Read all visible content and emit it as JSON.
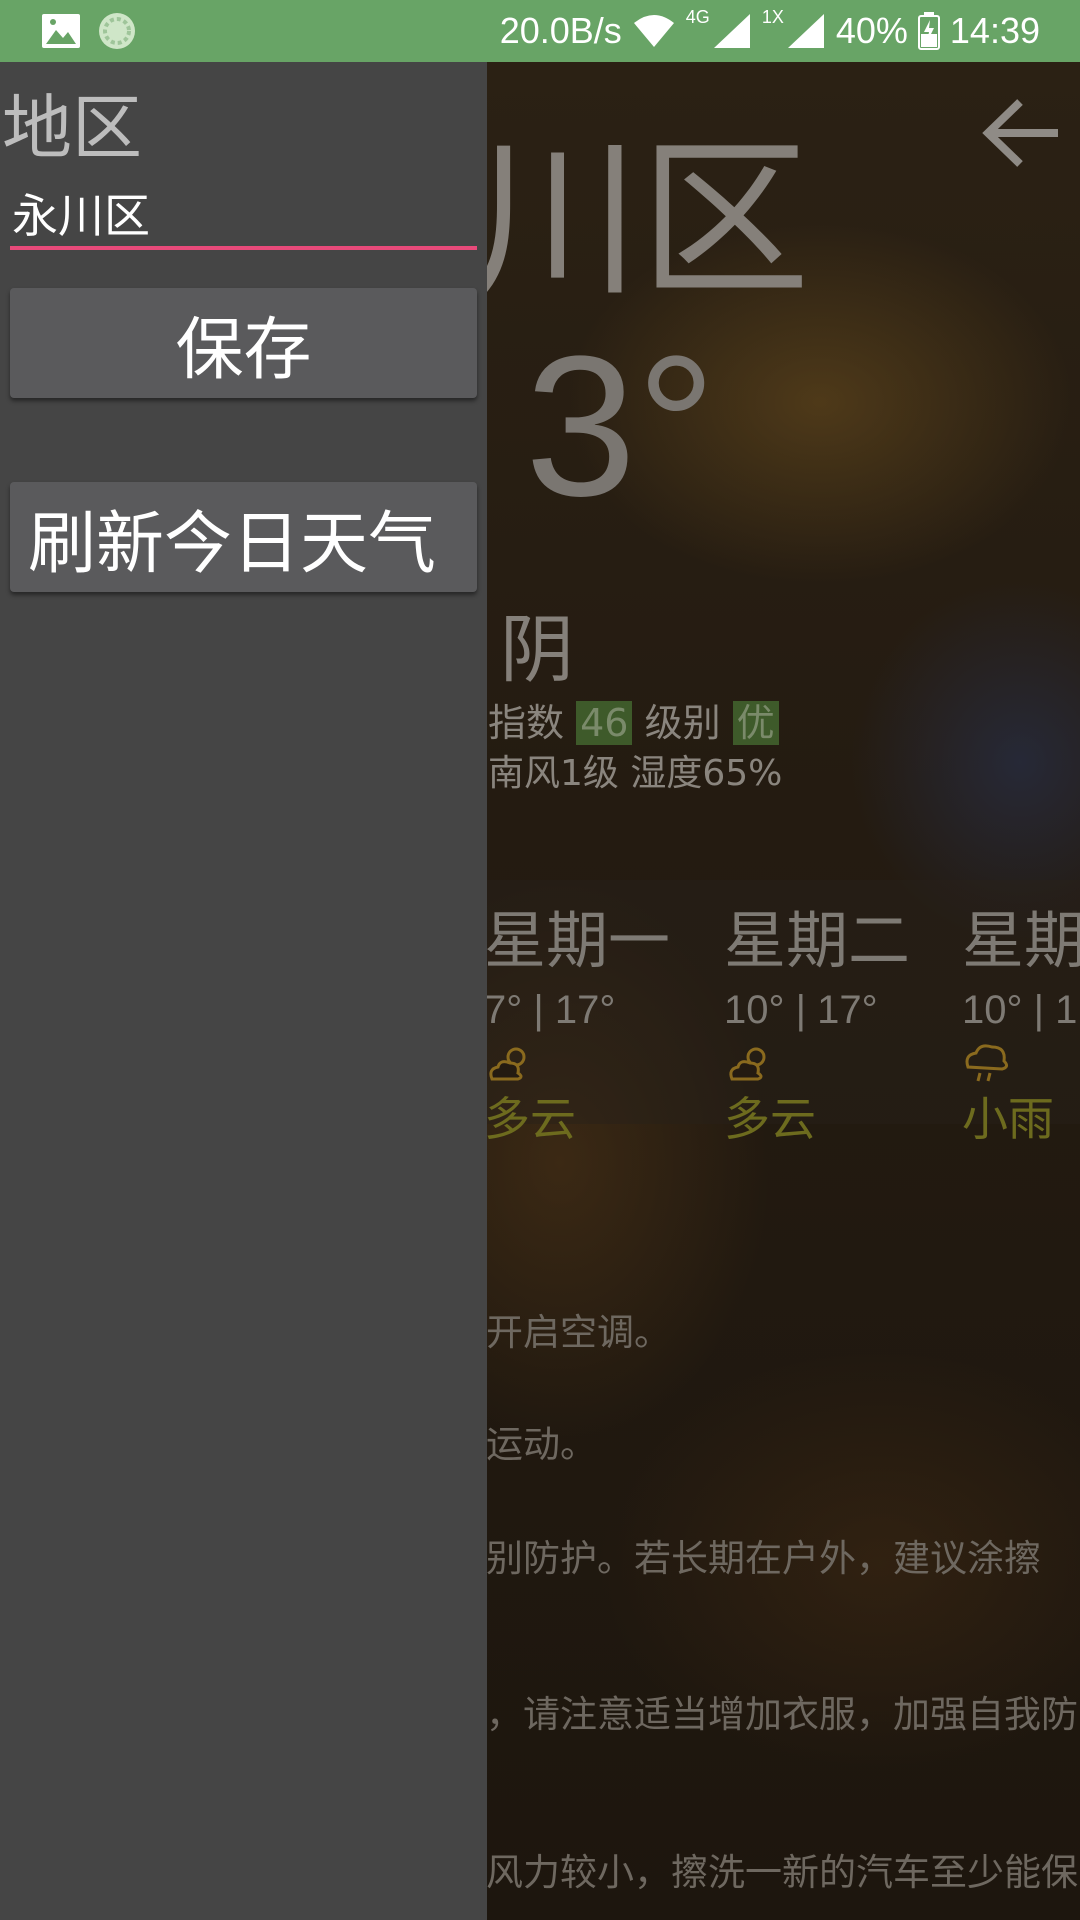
{
  "status_bar": {
    "net_speed": "20.0B/s",
    "net_4g": "4G",
    "net_1x": "1X",
    "battery": "40%",
    "time": "14:39"
  },
  "weather": {
    "city_partial": "川区",
    "temperature": "3°",
    "condition": "阴",
    "aqi_label": "指数",
    "aqi_value": "46",
    "level_label": "级别",
    "level_value": "优",
    "wind_humidity": "南风1级 湿度65%"
  },
  "forecast": [
    {
      "weekday": "星期一",
      "temp": "7° | 17°",
      "icon": "partly-cloudy-icon",
      "condition": "多云"
    },
    {
      "weekday": "星期二",
      "temp": "10° | 17°",
      "icon": "partly-cloudy-icon",
      "condition": "多云"
    },
    {
      "weekday": "星期",
      "temp": "10° | 1",
      "icon": "light-rain-icon",
      "condition": "小雨"
    }
  ],
  "tips": [
    "开启空调。",
    "运动。",
    "别防护。若长期在户外，建议涂擦",
    "，请注意适当增加衣服，加强自我防",
    "风力较小，擦洗一新的汽车至少能保"
  ],
  "drawer": {
    "title": "地区",
    "region_value": "永川区",
    "save_label": "保存",
    "refresh_label": "刷新今日天气"
  },
  "colors": {
    "status_bar": "#68a466",
    "drawer_bg": "#454545",
    "input_underline": "#e84a7a",
    "button_bg": "#5a5a5c"
  }
}
